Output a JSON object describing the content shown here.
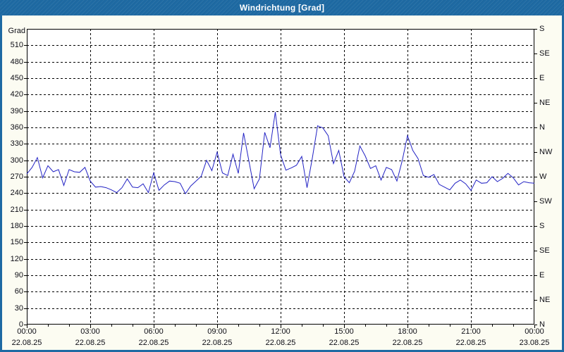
{
  "window": {
    "title": "Windrichtung [Grad]"
  },
  "colors": {
    "titlebar": "#1e6aa3",
    "window_background": "#fcfcf2",
    "plot_background": "#ffffff",
    "grid": "#000000",
    "line": "#2222c4",
    "label_text": "#0d0d15",
    "title_text": "#ffffff"
  },
  "chart_data": {
    "type": "line",
    "title": "Windrichtung [Grad]",
    "ylabel": "Grad",
    "ylim": [
      0,
      540
    ],
    "grid": true,
    "legend": "none",
    "line_color": "#2222c4",
    "y_ticks": [
      0,
      30,
      60,
      90,
      120,
      150,
      180,
      210,
      240,
      270,
      300,
      330,
      360,
      390,
      420,
      450,
      480,
      510
    ],
    "right_axis_ticks": [
      {
        "deg": 540,
        "label": "S"
      },
      {
        "deg": 495,
        "label": "SE"
      },
      {
        "deg": 450,
        "label": "E"
      },
      {
        "deg": 405,
        "label": "NE"
      },
      {
        "deg": 360,
        "label": "N"
      },
      {
        "deg": 315,
        "label": "NW"
      },
      {
        "deg": 270,
        "label": "W"
      },
      {
        "deg": 225,
        "label": "SW"
      },
      {
        "deg": 180,
        "label": "S"
      },
      {
        "deg": 135,
        "label": "SE"
      },
      {
        "deg": 90,
        "label": "E"
      },
      {
        "deg": 45,
        "label": "NE"
      },
      {
        "deg": 0,
        "label": "N"
      }
    ],
    "x_axis": {
      "range_hours": [
        0,
        24
      ],
      "grid_hours": 3,
      "minor_tick_hours": 1,
      "ticks": [
        {
          "hour": 0,
          "time": "00:00",
          "date": "22.08.25"
        },
        {
          "hour": 3,
          "time": "03:00",
          "date": "22.08.25"
        },
        {
          "hour": 6,
          "time": "06:00",
          "date": "22.08.25"
        },
        {
          "hour": 9,
          "time": "09:00",
          "date": "22.08.25"
        },
        {
          "hour": 12,
          "time": "12:00",
          "date": "22.08.25"
        },
        {
          "hour": 15,
          "time": "15:00",
          "date": "22.08.25"
        },
        {
          "hour": 18,
          "time": "18:00",
          "date": "22.08.25"
        },
        {
          "hour": 21,
          "time": "21:00",
          "date": "22.08.25"
        },
        {
          "hour": 24,
          "time": "00:00",
          "date": "23.08.25"
        }
      ]
    },
    "series": [
      {
        "name": "Windrichtung",
        "unit": "Grad",
        "sample_minutes": 15,
        "start": "22.08.25 00:00",
        "values": [
          275,
          287,
          305,
          268,
          290,
          279,
          283,
          254,
          283,
          279,
          278,
          287,
          262,
          251,
          252,
          250,
          246,
          241,
          250,
          266,
          251,
          250,
          257,
          241,
          277,
          245,
          255,
          262,
          261,
          258,
          239,
          253,
          262,
          271,
          300,
          281,
          315,
          277,
          272,
          311,
          276,
          350,
          299,
          248,
          266,
          351,
          323,
          388,
          310,
          282,
          286,
          291,
          307,
          250,
          304,
          363,
          359,
          345,
          294,
          318,
          270,
          259,
          280,
          326,
          308,
          285,
          290,
          264,
          287,
          283,
          262,
          299,
          345,
          318,
          303,
          272,
          269,
          274,
          256,
          251,
          246,
          258,
          264,
          257,
          245,
          264,
          258,
          259,
          270,
          261,
          267,
          276,
          268,
          255,
          261,
          259,
          258
        ]
      }
    ]
  }
}
